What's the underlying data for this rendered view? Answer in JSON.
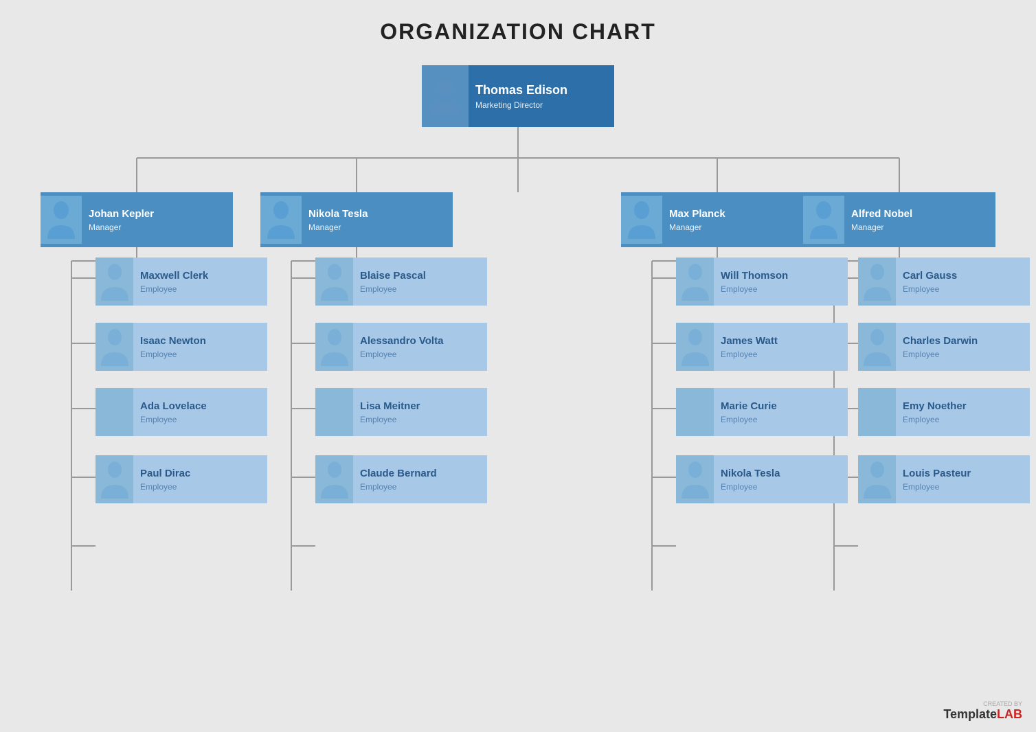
{
  "title": "ORGANIZATION CHART",
  "colors": {
    "top_manager_bg": "#2d6fa8",
    "top_manager_avatar": "#4a88be",
    "manager_bg": "#4a8ec2",
    "manager_avatar": "#6aabe0",
    "employee_bg": "#a8c8e8",
    "employee_avatar": "#8ab4d4",
    "line_color": "#999999",
    "text_white": "#ffffff",
    "title_color": "#222222",
    "bg": "#e8e8e8"
  },
  "top_node": {
    "name": "Thomas Edison",
    "role": "Marketing Director"
  },
  "managers": [
    {
      "name": "Johan Kepler",
      "role": "Manager"
    },
    {
      "name": "Nikola Tesla",
      "role": "Manager"
    },
    {
      "name": "Max Planck",
      "role": "Manager"
    },
    {
      "name": "Alfred Nobel",
      "role": "Manager"
    }
  ],
  "employees": [
    [
      {
        "name": "Maxwell Clerk",
        "role": "Employee"
      },
      {
        "name": "Isaac Newton",
        "role": "Employee"
      },
      {
        "name": "Ada Lovelace",
        "role": "Employee"
      },
      {
        "name": "Paul Dirac",
        "role": "Employee"
      }
    ],
    [
      {
        "name": "Blaise Pascal",
        "role": "Employee"
      },
      {
        "name": "Alessandro Volta",
        "role": "Employee"
      },
      {
        "name": "Lisa Meitner",
        "role": "Employee"
      },
      {
        "name": "Claude Bernard",
        "role": "Employee"
      }
    ],
    [
      {
        "name": "Will Thomson",
        "role": "Employee"
      },
      {
        "name": "James Watt",
        "role": "Employee"
      },
      {
        "name": "Marie Curie",
        "role": "Employee"
      },
      {
        "name": "Nikola Tesla",
        "role": "Employee"
      }
    ],
    [
      {
        "name": "Carl Gauss",
        "role": "Employee"
      },
      {
        "name": "Charles Darwin",
        "role": "Employee"
      },
      {
        "name": "Emy Noether",
        "role": "Employee"
      },
      {
        "name": "Louis Pasteur",
        "role": "Employee"
      }
    ]
  ],
  "watermark": {
    "created_by": "CREATED BY",
    "brand": "TemplateLAB"
  }
}
